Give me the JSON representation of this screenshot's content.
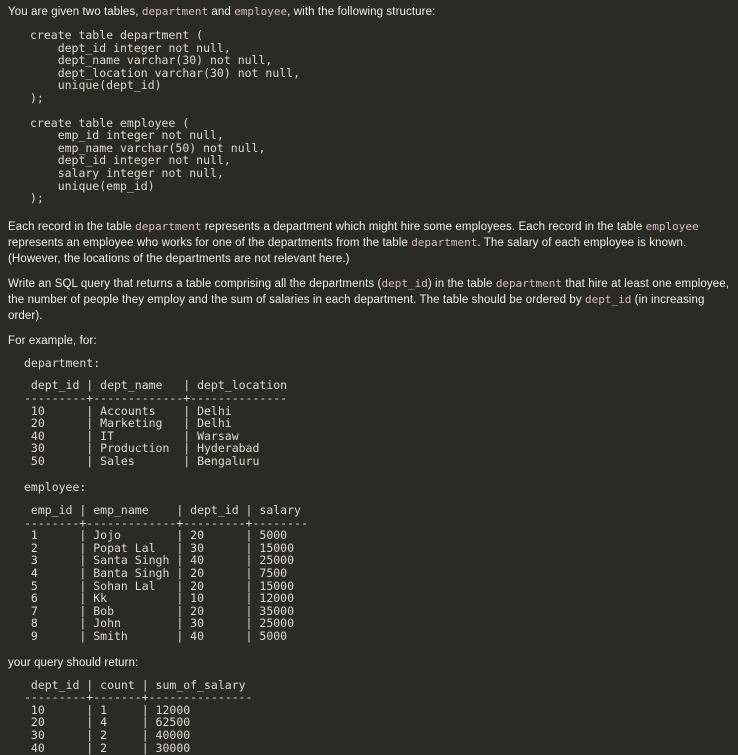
{
  "intro": {
    "before": "You are given two tables, ",
    "code1": "department",
    "middle": " and ",
    "code2": "employee",
    "after": ", with the following structure:"
  },
  "schema": {
    "department_ddl": "create table department (\n    dept_id integer not null,\n    dept_name varchar(30) not null,\n    dept_location varchar(30) not null,\n    unique(dept_id)\n);",
    "employee_ddl": "create table employee (\n    emp_id integer not null,\n    emp_name varchar(50) not null,\n    dept_id integer not null,\n    salary integer not null,\n    unique(emp_id)\n);"
  },
  "para_records": {
    "p1": "Each record in the table ",
    "c1": "department",
    "p2": " represents a department which might hire some employees. Each record in the table ",
    "c2": "employee",
    "p3": " represents an employee who works for one of the departments from the table ",
    "c3": "department",
    "p4": ". The salary of each employee is known. (However, the locations of the departments are not relevant here.)"
  },
  "para_task": {
    "p1": "Write an SQL query that returns a table comprising all the departments (",
    "c1": "dept_id",
    "p2": ") in the table ",
    "c2": "department",
    "p3": " that hire at least one employee, the number of people they employ and the sum of salaries in each department. The table should be ordered by ",
    "c3": "dept_id",
    "p4": " (in increasing order)."
  },
  "example_label": "For example, for:",
  "return_label": "your query should return:",
  "department_table": {
    "caption": "department:",
    "header": " dept_id | dept_name   | dept_location",
    "separator": "---------+-------------+--------------",
    "rows": [
      " 10      | Accounts    | Delhi",
      " 20      | Marketing   | Delhi",
      " 40      | IT          | Warsaw",
      " 30      | Production  | Hyderabad",
      " 50      | Sales       | Bengaluru"
    ]
  },
  "employee_table": {
    "caption": "employee:",
    "header": " emp_id | emp_name    | dept_id | salary",
    "separator": "--------+-------------+---------+--------",
    "rows": [
      " 1      | Jojo        | 20      | 5000",
      " 2      | Popat Lal   | 30      | 15000",
      " 3      | Santa Singh | 40      | 25000",
      " 4      | Banta Singh | 20      | 7500",
      " 5      | Sohan Lal   | 20      | 15000",
      " 6      | Kk          | 10      | 12000",
      " 7      | Bob         | 20      | 35000",
      " 8      | John        | 30      | 25000",
      " 9      | Smith       | 40      | 5000"
    ]
  },
  "result_table": {
    "header": " dept_id | count | sum_of_salary",
    "separator": "---------+-------+---------------",
    "rows": [
      " 10      | 1     | 12000",
      " 20      | 4     | 62500",
      " 30      | 2     | 40000",
      " 40      | 2     | 30000"
    ]
  }
}
